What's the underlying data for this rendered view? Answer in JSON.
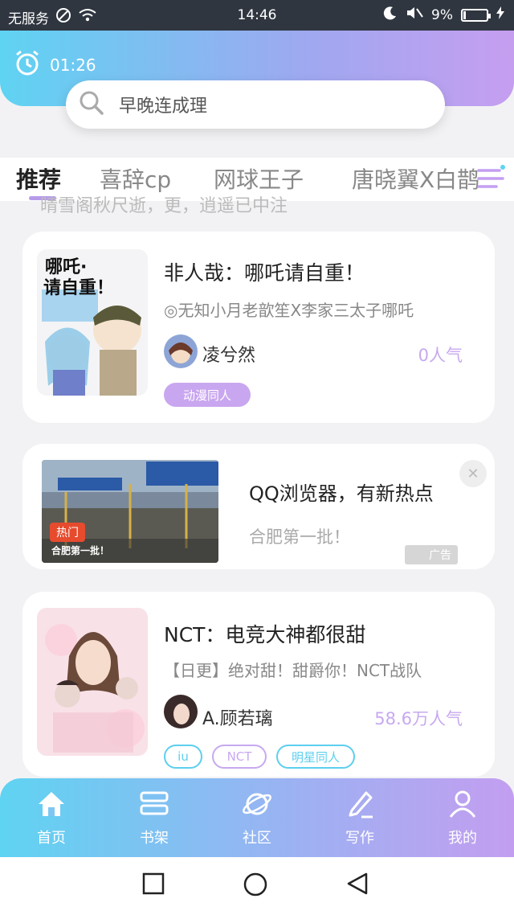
{
  "status_bar": {
    "carrier": "无服务",
    "time": "14:46",
    "battery": "9%",
    "battery_level": 0.09
  },
  "header": {
    "timer": "01:26",
    "search_placeholder": "早晚连成理"
  },
  "tabs": [
    {
      "label": "推荐",
      "active": true
    },
    {
      "label": "喜辞cp",
      "active": false
    },
    {
      "label": "网球王子",
      "active": false
    },
    {
      "label": "唐晓翼X白鹊",
      "active": false
    }
  ],
  "peek_text": "晴雪阁秋尺逝，更，逍遥已中注",
  "cards": [
    {
      "title": "非人哉：哪吒请自重！",
      "desc": "◎无知小月老歆笙X李家三太子哪吒",
      "author": "凌兮然",
      "popularity": "0人气",
      "tags": [
        "动漫同人"
      ],
      "cover_text_1": "哪吒·",
      "cover_text_2": "请自重！"
    },
    {
      "title": "NCT：电竞大神都很甜",
      "desc": "【日更】绝对甜！甜爵你！NCT战队",
      "author": "A.顾若璃",
      "popularity": "58.6万人气",
      "tags": [
        "iu",
        "NCT",
        "明星同人"
      ]
    }
  ],
  "ad": {
    "title": "QQ浏览器，有新热点",
    "subtitle": "合肥第一批！",
    "label": "广告",
    "badge": "热门",
    "caption": "合肥第一批！",
    "close": "✕"
  },
  "bottom_nav": [
    {
      "label": "首页",
      "icon": "home-icon"
    },
    {
      "label": "书架",
      "icon": "bookshelf-icon"
    },
    {
      "label": "社区",
      "icon": "planet-icon"
    },
    {
      "label": "写作",
      "icon": "pen-icon"
    },
    {
      "label": "我的",
      "icon": "user-icon"
    }
  ],
  "colors": {
    "accent": "#c9a6f0",
    "header_start": "#5fd3f2",
    "header_end": "#c69ef0",
    "tag_blue": "#5ccfee",
    "tag_purple": "#c7a9ef"
  }
}
